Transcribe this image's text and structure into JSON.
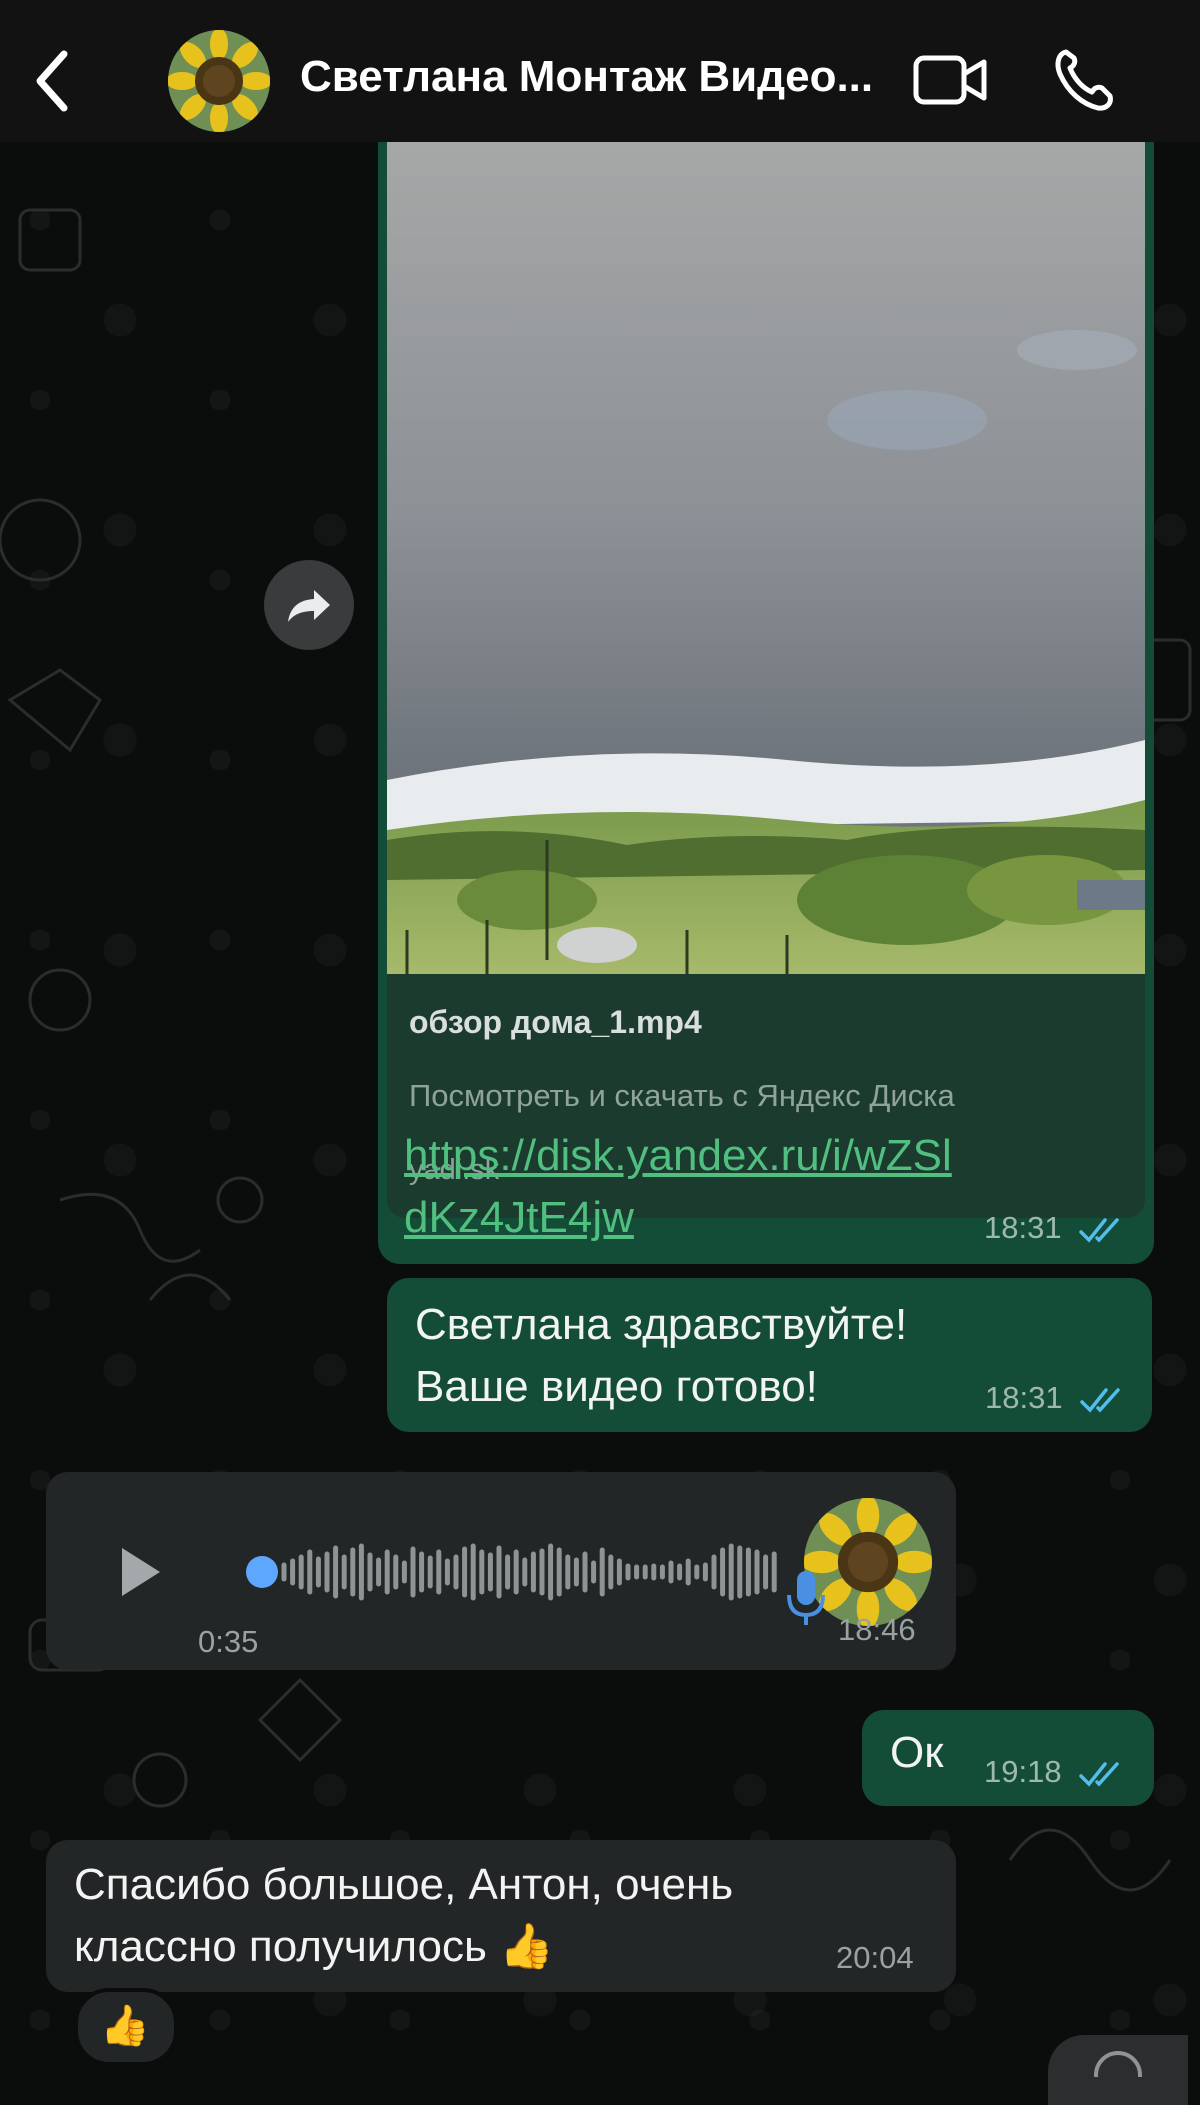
{
  "header": {
    "contact_name": "Светлана Монтаж Видео...",
    "icons": [
      "chevron-left-icon",
      "video-camera-icon",
      "phone-icon"
    ]
  },
  "messages": {
    "preview": {
      "title": "обзор дома_1.mp4",
      "description": "Посмотреть и скачать с Яндекс Диска",
      "domain": "yadi.sk",
      "url": "https://disk.yandex.ru/i/wZSldKz4JtE4jw",
      "time": "18:31"
    },
    "greeting": {
      "text": "Светлана здравствуйте!\nВаше видео готово!",
      "time": "18:31"
    },
    "voice": {
      "duration": "0:35",
      "time": "18:46"
    },
    "ok": {
      "text": "Ок",
      "time": "19:18"
    },
    "thanks": {
      "text": "Спасибо большое, Антон, очень\nклассно получилось 👍",
      "time": "20:04",
      "reaction": "👍"
    }
  },
  "colors": {
    "outgoing_bubble": "#144d37",
    "incoming_bubble": "#232626",
    "link": "#50bf7f",
    "read_ticks": "#53bdeb"
  }
}
